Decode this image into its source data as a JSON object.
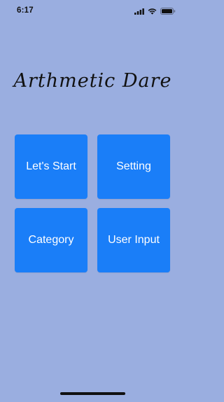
{
  "status_bar": {
    "time": "6:17",
    "icons": [
      "signal-icon",
      "wifi-icon",
      "battery-icon"
    ]
  },
  "app": {
    "title": "Arthmetic Dare"
  },
  "menu": {
    "buttons": [
      {
        "label": "Let's Start"
      },
      {
        "label": "Setting"
      },
      {
        "label": "Category"
      },
      {
        "label": "User Input"
      }
    ]
  },
  "colors": {
    "background": "#9aaee0",
    "button": "#1a7ef8",
    "button_text": "#ffffff"
  }
}
